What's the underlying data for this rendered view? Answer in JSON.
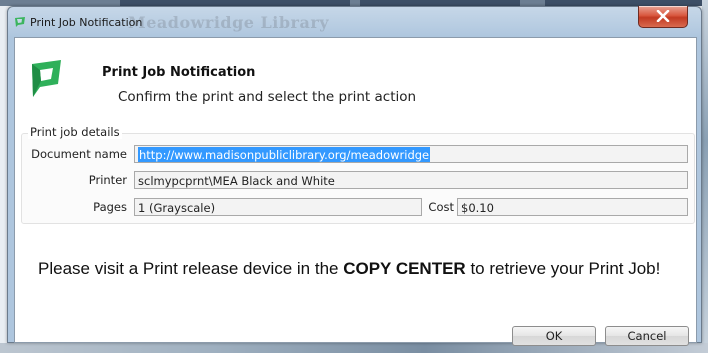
{
  "background": {
    "faded_title": "Meadowridge Library"
  },
  "window": {
    "title": "Print Job Notification",
    "close_icon": "close-x-icon"
  },
  "header": {
    "title": "Print Job Notification",
    "subtitle": "Confirm the print and select the print action",
    "logo_icon": "papercut-logo-icon"
  },
  "details": {
    "legend": "Print job details",
    "document_name_label": "Document name",
    "document_name_value": "http://www.madisonpubliclibrary.org/meadowridge",
    "printer_label": "Printer",
    "printer_value": "sclmypcprnt\\MEA Black and White",
    "pages_label": "Pages",
    "pages_value": "1  (Grayscale)",
    "cost_label": "Cost",
    "cost_value": "$0.10"
  },
  "message": {
    "part1": "Please visit a Print release device in the ",
    "emphasis": "COPY CENTER",
    "part2": " to retrieve your Print Job!"
  },
  "buttons": {
    "ok_label": "OK",
    "cancel_label": "Cancel"
  },
  "colors": {
    "selection": "#3399ff",
    "close_button": "#d9583f",
    "logo_green": "#2fb05a"
  }
}
